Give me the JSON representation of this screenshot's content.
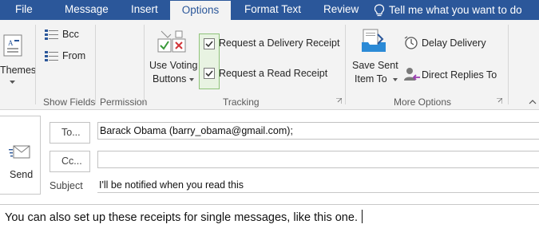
{
  "tabs": {
    "file": "File",
    "message": "Message",
    "insert": "Insert",
    "options": "Options",
    "format_text": "Format Text",
    "review": "Review",
    "tell_me": "Tell me what you want to do"
  },
  "ribbon": {
    "themes": {
      "label": "Themes"
    },
    "show_fields": {
      "bcc": "Bcc",
      "from": "From",
      "group_label": "Show Fields"
    },
    "permission": {
      "group_label": "Permission"
    },
    "tracking": {
      "voting_line1": "Use Voting",
      "voting_line2": "Buttons",
      "delivery_receipt": "Request a Delivery Receipt",
      "read_receipt": "Request a Read Receipt",
      "delivery_checked": true,
      "read_checked": true,
      "group_label": "Tracking"
    },
    "more_options": {
      "save_sent_line1": "Save Sent",
      "save_sent_line2": "Item To",
      "delay_delivery": "Delay Delivery",
      "direct_replies": "Direct Replies To",
      "group_label": "More Options"
    }
  },
  "compose": {
    "send_label": "Send",
    "to_button": "To...",
    "cc_button": "Cc...",
    "subject_label": "Subject",
    "to_value": "Barack Obama (barry_obama@gmail.com);",
    "cc_value": "",
    "subject_value": "I'll be notified when you read this",
    "body_text": "You can also set up these receipts for single messages, like this one."
  },
  "colors": {
    "accent": "#2b579a",
    "ribbon_bg": "#f3f3f3",
    "highlight_green": "#8fc37a"
  }
}
